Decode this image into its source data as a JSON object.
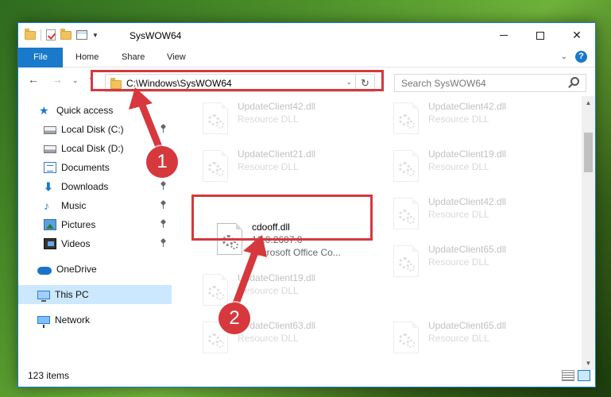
{
  "window": {
    "title": "SysWOW64",
    "controls": {
      "minimize": "—",
      "maximize": "□",
      "close": "✕"
    }
  },
  "ribbon": {
    "tabs": [
      "File",
      "Home",
      "Share",
      "View"
    ],
    "help": "?"
  },
  "address": {
    "path": "C:\\Windows\\SysWOW64",
    "search_placeholder": "Search SysWOW64"
  },
  "nav_pane": {
    "items": [
      {
        "label": "Quick access",
        "icon": "star-icon",
        "pinned": false
      },
      {
        "label": "Local Disk (C:)",
        "icon": "drive-icon",
        "pinned": true
      },
      {
        "label": "Local Disk (D:)",
        "icon": "drive-icon",
        "pinned": false
      },
      {
        "label": "Documents",
        "icon": "documents-icon",
        "pinned": true
      },
      {
        "label": "Downloads",
        "icon": "downloads-icon",
        "pinned": true
      },
      {
        "label": "Music",
        "icon": "music-icon",
        "pinned": true
      },
      {
        "label": "Pictures",
        "icon": "pictures-icon",
        "pinned": true
      },
      {
        "label": "Videos",
        "icon": "videos-icon",
        "pinned": true
      },
      {
        "label": "OneDrive",
        "icon": "onedrive-icon",
        "pinned": false
      },
      {
        "label": "This PC",
        "icon": "this-pc-icon",
        "pinned": false,
        "selected": true
      },
      {
        "label": "Network",
        "icon": "network-icon",
        "pinned": false
      }
    ]
  },
  "files": [
    {
      "name": "UpdateClient42.dll",
      "line2": "Resource DLL",
      "line3": "",
      "faded": true
    },
    {
      "name": "UpdateClient42.dll",
      "line2": "Resource DLL",
      "line3": "",
      "faded": true
    },
    {
      "name": "UpdateClient21.dll",
      "line2": "Resource DLL",
      "line3": "",
      "faded": true
    },
    {
      "name": "UpdateClient19.dll",
      "line2": "Resource DLL",
      "line3": "",
      "faded": true
    },
    {
      "name": "cdooff.dll",
      "line2": "10.0.2607.0",
      "line3": "Microsoft Office Co...",
      "faded": false
    },
    {
      "name": "UpdateClient42.dll",
      "line2": "Resource DLL",
      "line3": "",
      "faded": true
    },
    {
      "name": "UpdateClient19.dll",
      "line2": "Resource DLL",
      "line3": "",
      "faded": true
    },
    {
      "name": "UpdateClient65.dll",
      "line2": "Resource DLL",
      "line3": "",
      "faded": true
    },
    {
      "name": "UpdateClient63.dll",
      "line2": "Resource DLL",
      "line3": "",
      "faded": true
    },
    {
      "name": "UpdateClient65.dll",
      "line2": "Resource DLL",
      "line3": "",
      "faded": true
    }
  ],
  "status": {
    "item_count": "123 items"
  },
  "callouts": [
    "1",
    "2"
  ],
  "colors": {
    "accent": "#1979ca",
    "highlight": "#d6383d",
    "selected_bg": "#cce8ff"
  }
}
